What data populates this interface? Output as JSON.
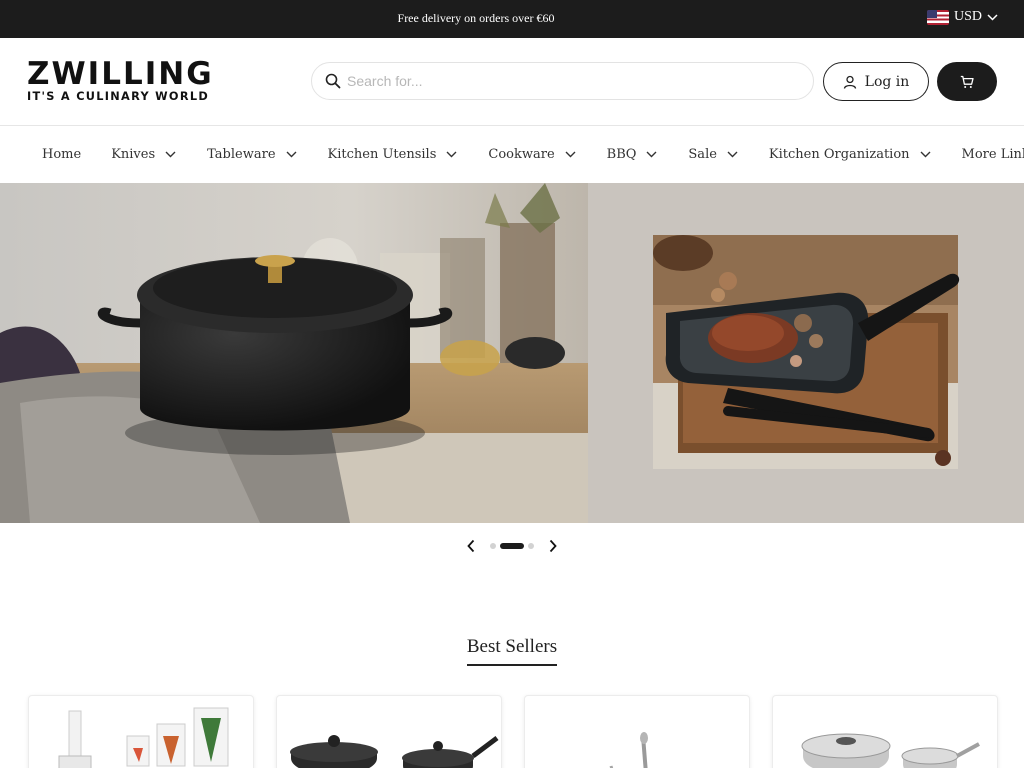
{
  "topbar": {
    "promo": "Free delivery on orders over €60",
    "currency": "USD",
    "currency_flag_icon": "us-flag-icon"
  },
  "header": {
    "brand": "ZWILLING",
    "tagline": "IT'S A CULINARY WORLD",
    "search_placeholder": "Search for...",
    "search_icon": "search-icon",
    "login_label": "Log in",
    "login_icon": "user-icon",
    "cart_icon": "cart-icon"
  },
  "nav": {
    "items": [
      {
        "label": "Home",
        "has_dropdown": false
      },
      {
        "label": "Knives",
        "has_dropdown": true
      },
      {
        "label": "Tableware",
        "has_dropdown": true
      },
      {
        "label": "Kitchen Utensils",
        "has_dropdown": true
      },
      {
        "label": "Cookware",
        "has_dropdown": true
      },
      {
        "label": "BBQ",
        "has_dropdown": true
      },
      {
        "label": "Sale",
        "has_dropdown": true
      },
      {
        "label": "Kitchen Organization",
        "has_dropdown": true
      },
      {
        "label": "More Links",
        "has_dropdown": true
      }
    ]
  },
  "hero": {
    "slide_count": 3,
    "active_slide": 2,
    "left_image": "black-dutch-oven-on-kitchen-counter",
    "right_image": "steak-in-grill-pan-on-cutting-board"
  },
  "best_sellers": {
    "title": "Best Sellers",
    "products": [
      {
        "image": "vacuum-storage-containers-and-bags"
      },
      {
        "image": "black-nonstick-pot-set"
      },
      {
        "image": "stainless-steel-utensil"
      },
      {
        "image": "stainless-steel-cookware-set"
      }
    ]
  },
  "colors": {
    "topbar_bg": "#1c1c1c",
    "accent_dark": "#1c1c1c",
    "border_light": "#e6e6e6"
  }
}
